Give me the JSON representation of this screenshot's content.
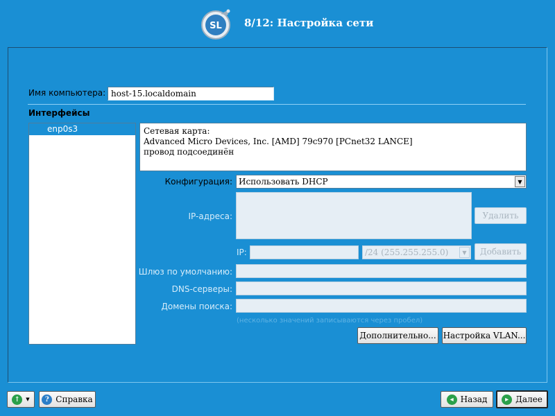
{
  "header": {
    "logo_text": "SL",
    "title": "8/12: Настройка сети"
  },
  "hostname": {
    "label": "Имя компьютера:",
    "value": "host-15.localdomain"
  },
  "interfaces": {
    "title": "Интерфейсы",
    "items": [
      "enp0s3"
    ]
  },
  "info": {
    "lines": [
      "Сетевая карта:",
      "Advanced Micro Devices, Inc. [AMD] 79c970 [PCnet32 LANCE]",
      "провод подсоединён"
    ]
  },
  "config": {
    "label": "Конфигурация:",
    "value": "Использовать DHCP"
  },
  "ip_addresses": {
    "label": "IP-адреса:",
    "delete_button": "Удалить"
  },
  "ip_entry": {
    "label": "IP:",
    "value": "",
    "mask": "/24 (255.255.255.0)",
    "add_button": "Добавить"
  },
  "gateway": {
    "label": "Шлюз по умолчанию:",
    "value": ""
  },
  "dns": {
    "label": "DNS-серверы:",
    "value": ""
  },
  "search_domains": {
    "label": "Домены поиска:",
    "value": "",
    "hint": "(несколько значений записываются через пробел)"
  },
  "buttons": {
    "advanced": "Дополнительно...",
    "vlan": "Настройка VLAN...",
    "help": "Справка",
    "back": "Назад",
    "next": "Далее"
  },
  "colors": {
    "background": "#1a8fd4",
    "selection": "#1a8fd4",
    "help_icon": "#2a7ec8",
    "nav_icon": "#2aa04a"
  }
}
